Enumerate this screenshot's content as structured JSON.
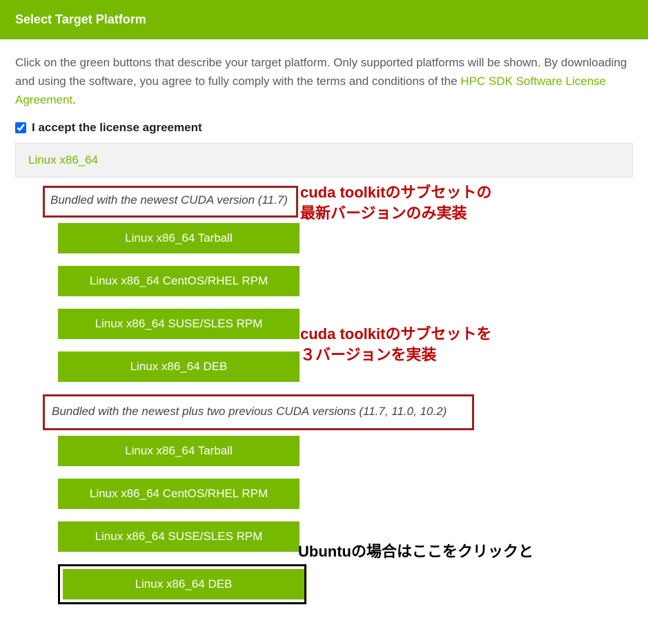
{
  "header": {
    "title": "Select Target Platform"
  },
  "description": {
    "text_before_link": "Click on the green buttons that describe your target platform. Only supported platforms will be shown. By downloading and using the software, you agree to fully comply with the terms and conditions of the ",
    "link_text": "HPC SDK Software License Agreement",
    "text_after_link": "."
  },
  "license": {
    "label": "I accept the license agreement",
    "checked": true
  },
  "platform": {
    "title": "Linux x86_64"
  },
  "bundle1": {
    "header": "Bundled with the newest CUDA version (11.7)",
    "buttons": [
      "Linux x86_64 Tarball",
      "Linux x86_64 CentOS/RHEL RPM",
      "Linux x86_64 SUSE/SLES RPM",
      "Linux x86_64 DEB"
    ]
  },
  "bundle2": {
    "header": "Bundled with the newest plus two previous CUDA versions (11.7, 11.0, 10.2)",
    "buttons": [
      "Linux x86_64 Tarball",
      "Linux x86_64 CentOS/RHEL RPM",
      "Linux x86_64 SUSE/SLES RPM",
      "Linux x86_64 DEB"
    ]
  },
  "annotations": {
    "anno1_line1": "cuda toolkitのサブセットの",
    "anno1_line2": "最新バージョンのみ実装",
    "anno2_line1": "cuda toolkitのサブセットを",
    "anno2_line2": "３バージョンを実装",
    "anno3_line1": "Ubuntuの場合はここをクリックと"
  }
}
